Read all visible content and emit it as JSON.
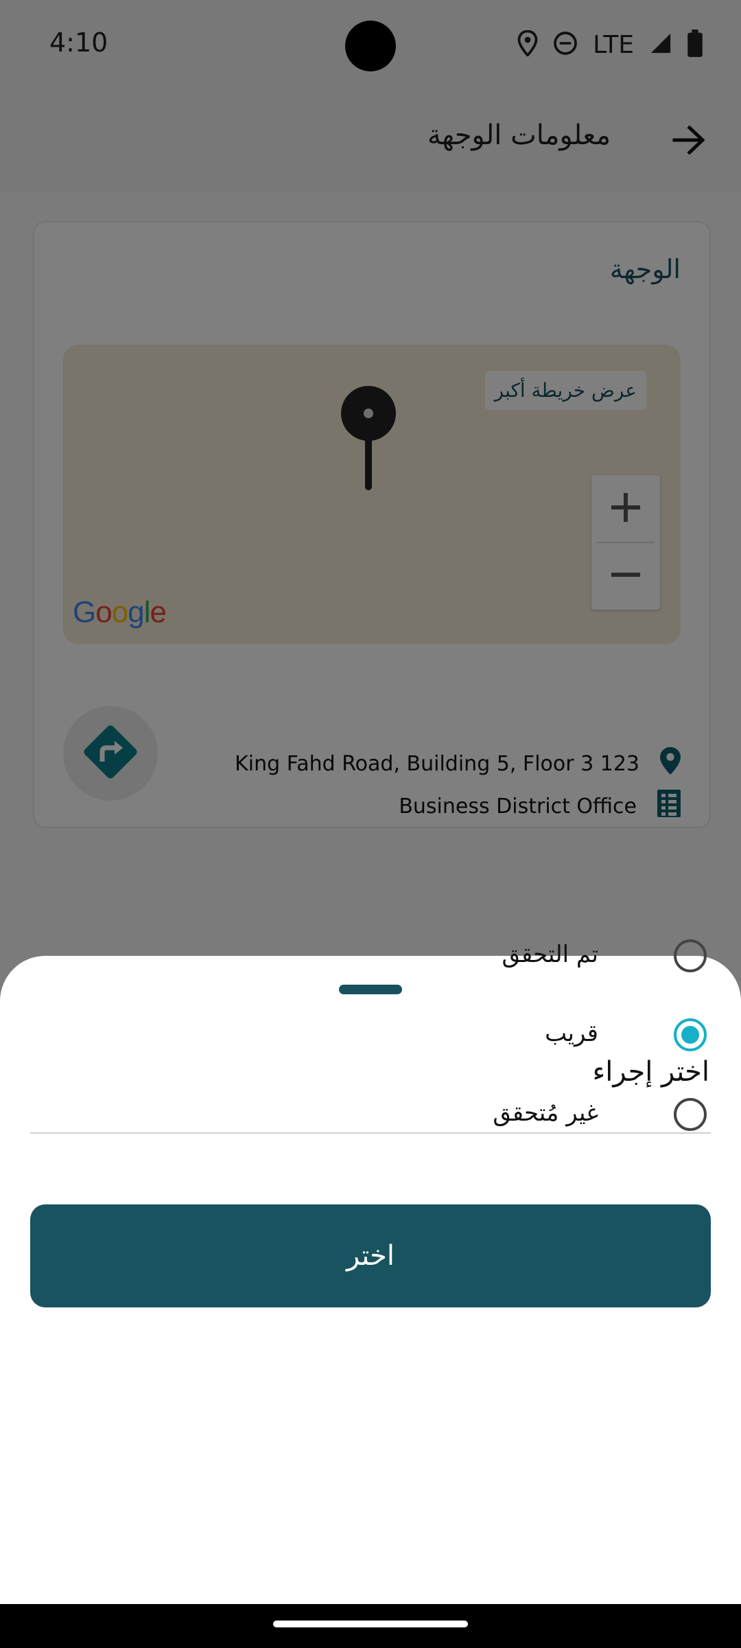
{
  "status_bar": {
    "time": "4:10",
    "network": "LTE",
    "icons": [
      "location-icon",
      "do-not-disturb-icon",
      "signal-icon",
      "battery-icon"
    ]
  },
  "app_bar": {
    "title": "معلومات الوجهة",
    "back_icon": "arrow-right-icon"
  },
  "card": {
    "title": "الوجهة",
    "map": {
      "larger_map_label": "عرض خريطة أكبر",
      "zoom_in": "+",
      "zoom_out": "−",
      "logo": "Google"
    },
    "address": "King Fahd Road, Building 5, Floor 3 123",
    "building": "Business District Office",
    "directions_icon": "directions-icon"
  },
  "sheet": {
    "title": "اختر إجراء",
    "options": [
      {
        "label": "تم التحقق",
        "selected": false
      },
      {
        "label": "قريب",
        "selected": true
      },
      {
        "label": "غير مُتحقق",
        "selected": false
      }
    ],
    "confirm_label": "اختر"
  },
  "colors": {
    "accent": "#19535f",
    "radio_selected": "#16b0c8",
    "map_bg": "#f4ead4"
  }
}
